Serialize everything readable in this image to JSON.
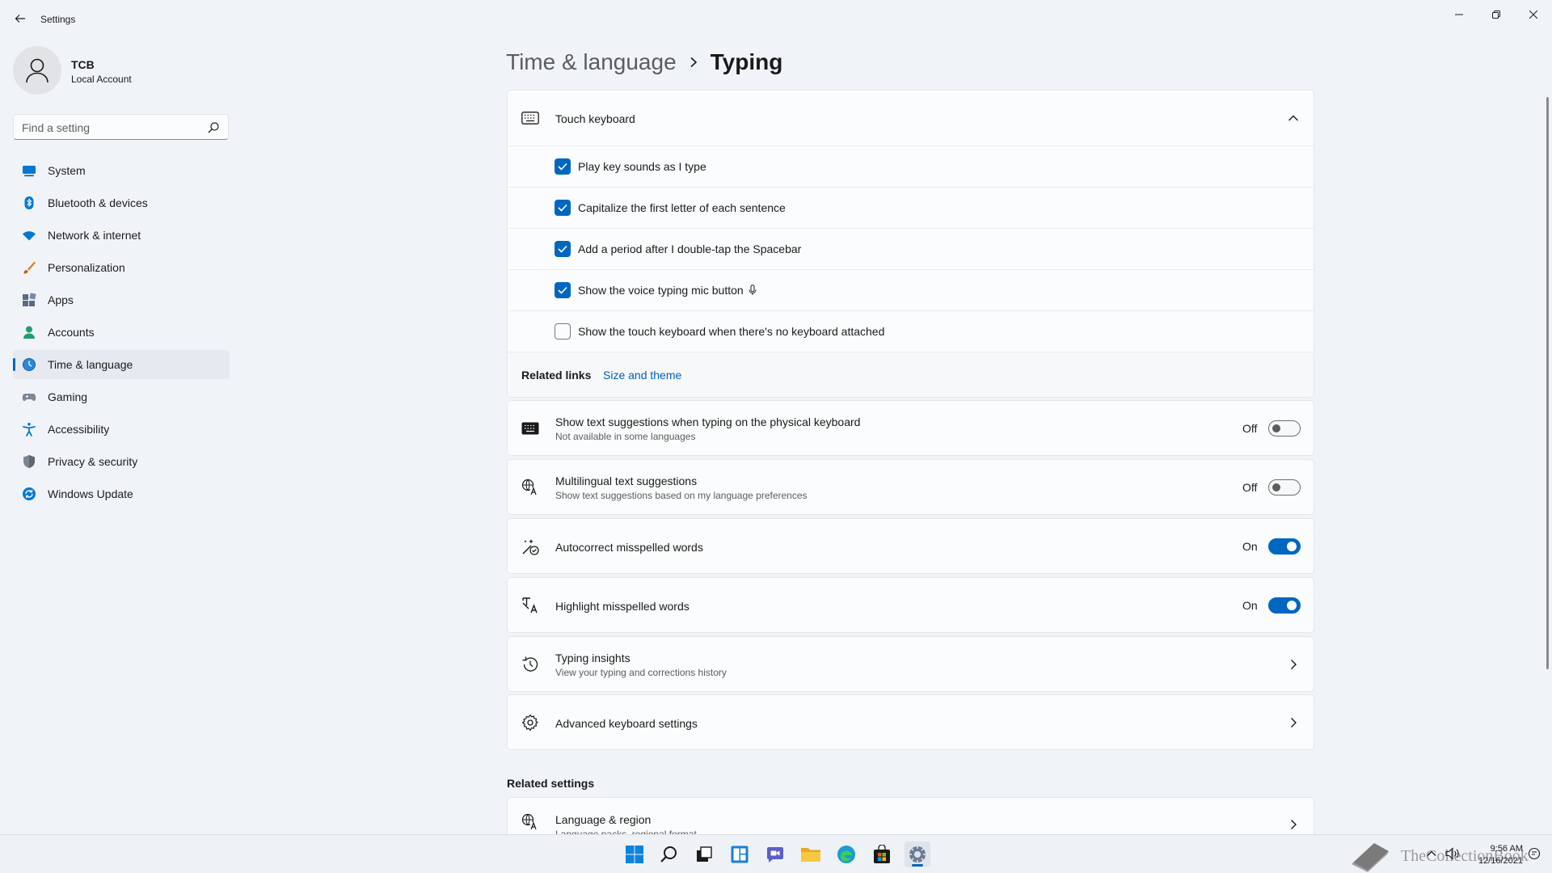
{
  "window": {
    "title": "Settings"
  },
  "profile": {
    "name": "TCB",
    "account_type": "Local Account"
  },
  "search": {
    "placeholder": "Find a setting"
  },
  "sidebar": {
    "items": [
      {
        "label": "System",
        "icon": "monitor-icon"
      },
      {
        "label": "Bluetooth & devices",
        "icon": "bluetooth-icon"
      },
      {
        "label": "Network & internet",
        "icon": "wifi-icon"
      },
      {
        "label": "Personalization",
        "icon": "brush-icon"
      },
      {
        "label": "Apps",
        "icon": "apps-icon"
      },
      {
        "label": "Accounts",
        "icon": "person-icon"
      },
      {
        "label": "Time & language",
        "icon": "globe-clock-icon",
        "active": true
      },
      {
        "label": "Gaming",
        "icon": "gamepad-icon"
      },
      {
        "label": "Accessibility",
        "icon": "accessibility-icon"
      },
      {
        "label": "Privacy & security",
        "icon": "shield-icon"
      },
      {
        "label": "Windows Update",
        "icon": "update-icon"
      }
    ]
  },
  "breadcrumb": {
    "parent": "Time & language",
    "current": "Typing"
  },
  "touch_keyboard": {
    "title": "Touch keyboard",
    "expanded": true,
    "options": [
      {
        "label": "Play key sounds as I type",
        "checked": true
      },
      {
        "label": "Capitalize the first letter of each sentence",
        "checked": true
      },
      {
        "label": "Add a period after I double-tap the Spacebar",
        "checked": true
      },
      {
        "label": "Show the voice typing mic button",
        "checked": true
      },
      {
        "label": "Show the touch keyboard when there's no keyboard attached",
        "checked": false
      }
    ],
    "related_links_label": "Related links",
    "related_link": "Size and theme"
  },
  "settings": [
    {
      "title": "Show text suggestions when typing on the physical keyboard",
      "subtitle": "Not available in some languages",
      "state": "Off",
      "on": false
    },
    {
      "title": "Multilingual text suggestions",
      "subtitle": "Show text suggestions based on my language preferences",
      "state": "Off",
      "on": false
    },
    {
      "title": "Autocorrect misspelled words",
      "state": "On",
      "on": true
    },
    {
      "title": "Highlight misspelled words",
      "state": "On",
      "on": true
    }
  ],
  "typing_insights": {
    "title": "Typing insights",
    "subtitle": "View your typing and corrections history"
  },
  "advanced_keyboard": {
    "title": "Advanced keyboard settings"
  },
  "related_settings": {
    "heading": "Related settings",
    "language_region": {
      "title": "Language & region",
      "subtitle": "Language packs, regional format"
    }
  },
  "taskbar": {
    "time": "9:56 AM",
    "date": "12/16/2021",
    "watermark": "TheCollectionBook"
  },
  "colors": {
    "accent": "#0067c0",
    "background": "#f0f4f9",
    "card": "#fbfcfd",
    "link": "#005fb8"
  }
}
